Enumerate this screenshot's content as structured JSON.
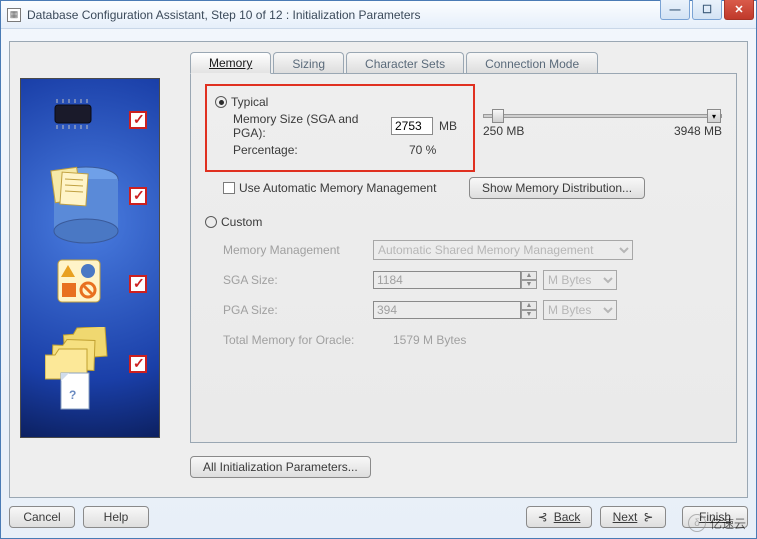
{
  "window": {
    "title": "Database Configuration Assistant, Step 10 of 12 : Initialization Parameters"
  },
  "tabs": {
    "memory": "Memory",
    "sizing": "Sizing",
    "charsets": "Character Sets",
    "connmode": "Connection Mode"
  },
  "memory": {
    "typical_label": "Typical",
    "memsize_label": "Memory Size (SGA and PGA):",
    "memsize_value": "2753",
    "memsize_unit": "MB",
    "percentage_label": "Percentage:",
    "percentage_value": "70 %",
    "slider_min": "250 MB",
    "slider_max": "3948 MB",
    "auto_mm_label": "Use Automatic Memory Management",
    "show_dist_label": "Show Memory Distribution...",
    "custom_label": "Custom",
    "mm_label": "Memory Management",
    "mm_value": "Automatic Shared Memory Management",
    "sga_label": "SGA Size:",
    "sga_value": "1184",
    "pga_label": "PGA Size:",
    "pga_value": "394",
    "unit_option": "M Bytes",
    "total_label": "Total Memory for Oracle:",
    "total_value": "1579 M Bytes"
  },
  "buttons": {
    "all_params": "All Initialization Parameters...",
    "cancel": "Cancel",
    "help": "Help",
    "back": "Back",
    "next": "Next",
    "finish": "Finish"
  },
  "watermark": "亿速云"
}
